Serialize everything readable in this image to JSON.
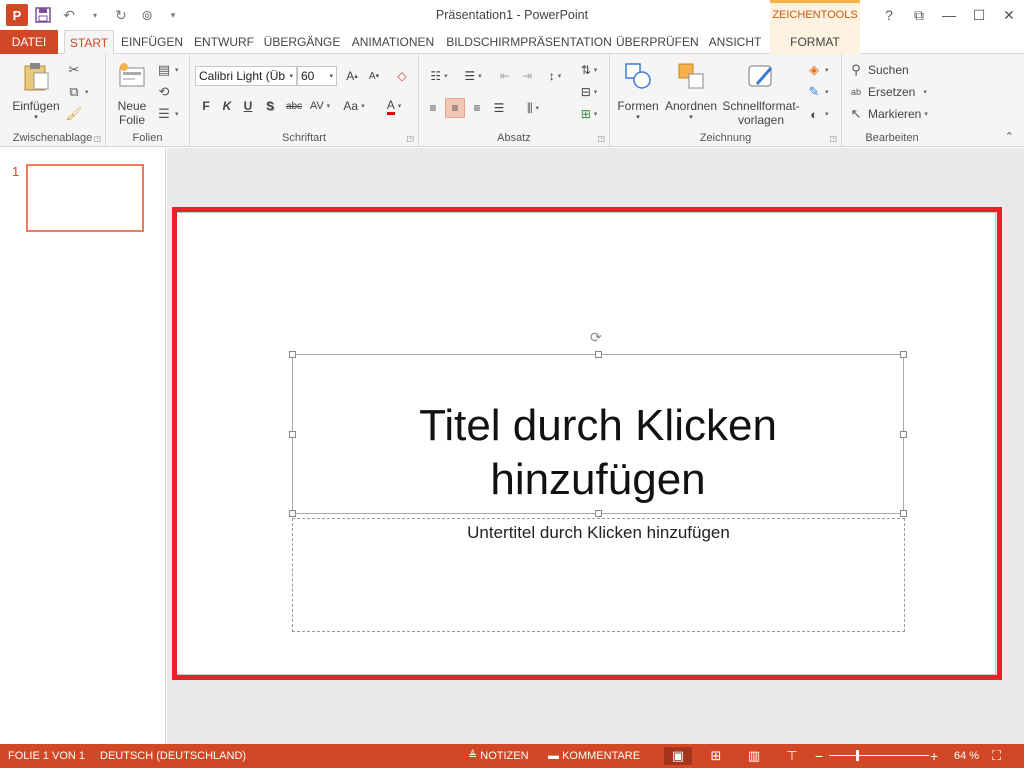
{
  "window": {
    "title": "Präsentation1 - PowerPoint",
    "context_tab_header": "ZEICHENTOOLS",
    "help": "?",
    "min": "—",
    "max": "☐",
    "close": "✕"
  },
  "qat": {
    "logo": "P",
    "save": "💾",
    "undo": "↶",
    "redo": "↻",
    "present": "⊚",
    "customize": "▾"
  },
  "tabs": {
    "datei": "DATEI",
    "start": "START",
    "einfuegen": "EINFÜGEN",
    "entwurf": "ENTWURF",
    "uebergaenge": "ÜBERGÄNGE",
    "animationen": "ANIMATIONEN",
    "bildschirm": "BILDSCHIRMPRÄSENTATION",
    "ueberpruefen": "ÜBERPRÜFEN",
    "ansicht": "ANSICHT",
    "format": "FORMAT"
  },
  "ribbon": {
    "zwischenablage": {
      "label": "Zwischenablage",
      "einfuegen": "Einfügen"
    },
    "folien": {
      "label": "Folien",
      "neue": "Neue",
      "folie": "Folie"
    },
    "schriftart": {
      "label": "Schriftart",
      "font": "Calibri Light (Üb",
      "size": "60",
      "bold": "F",
      "italic": "K",
      "underline": "U",
      "shadow": "S",
      "strike": "abc",
      "spacing": "AV",
      "case": "Aa",
      "color": "A"
    },
    "absatz": {
      "label": "Absatz"
    },
    "zeichnung": {
      "label": "Zeichnung",
      "formen": "Formen",
      "anordnen": "Anordnen",
      "schnell1": "Schnellformat-",
      "schnell2": "vorlagen"
    },
    "bearbeiten": {
      "label": "Bearbeiten",
      "suchen": "Suchen",
      "ersetzen": "Ersetzen",
      "markieren": "Markieren"
    }
  },
  "thumbnails": {
    "slide_number": "1"
  },
  "slide": {
    "title_line1": "Titel durch Klicken",
    "title_line2": "hinzufügen",
    "subtitle": "Untertitel durch Klicken hinzufügen"
  },
  "status": {
    "slide_info": "FOLIE 1 VON 1",
    "language": "DEUTSCH (DEUTSCHLAND)",
    "notes": "NOTIZEN",
    "comments": "KOMMENTARE",
    "zoom": "64 %",
    "zoom_value": 64
  },
  "colors": {
    "accent": "#d24726",
    "highlight": "#e8202a",
    "context": "#f3b34a"
  }
}
